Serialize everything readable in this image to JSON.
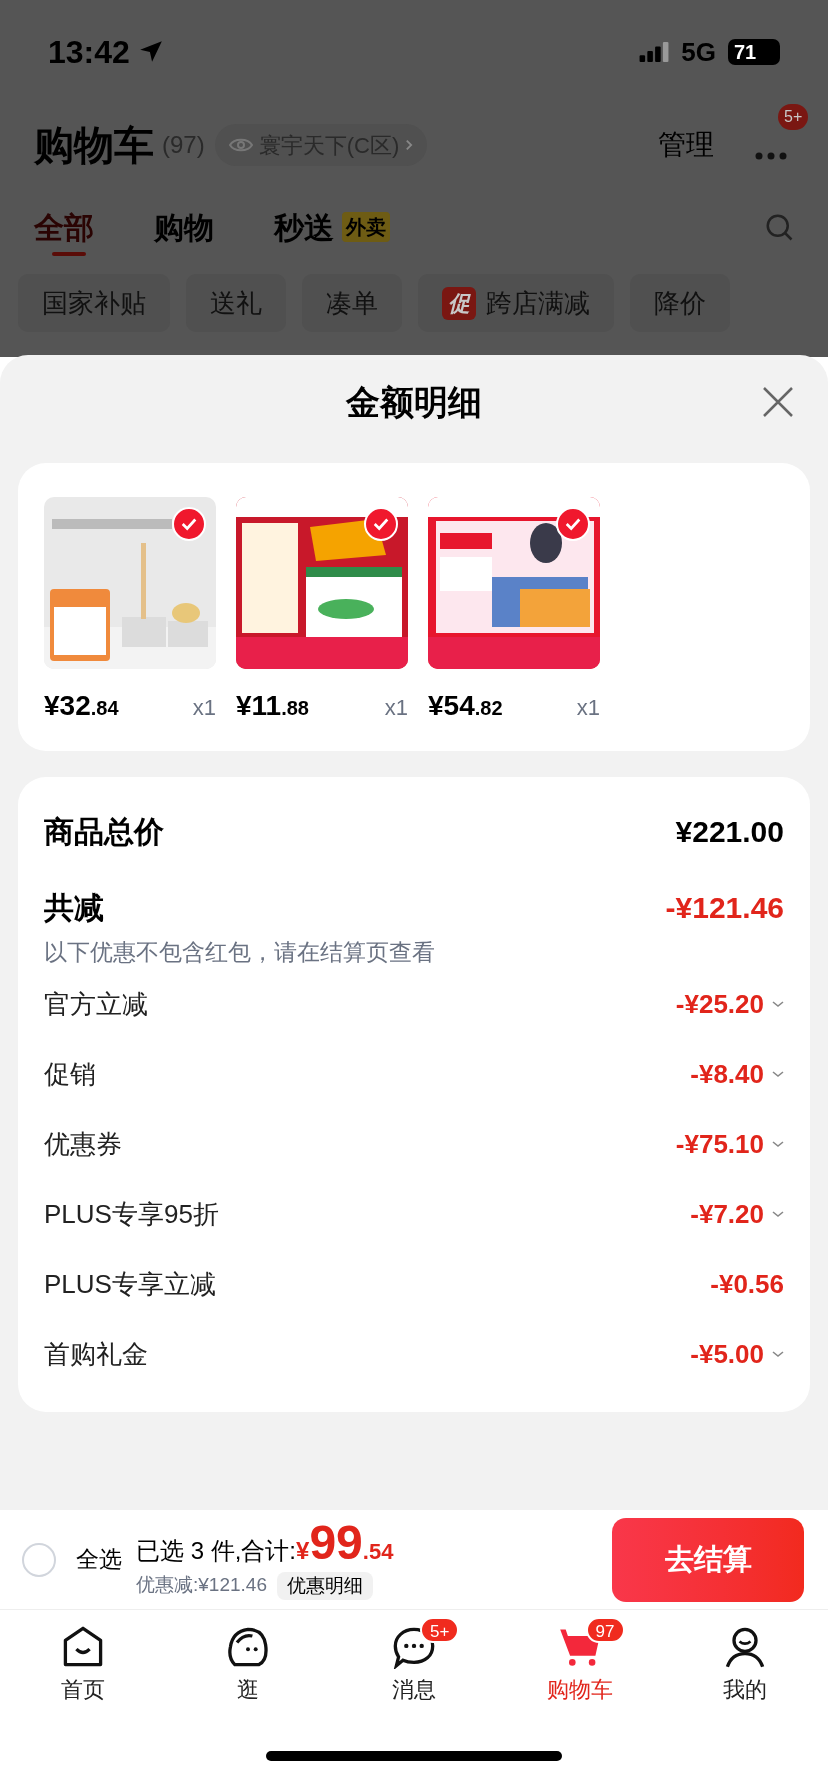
{
  "status_bar": {
    "time": "13:42",
    "network": "5G",
    "battery": "71"
  },
  "header": {
    "title": "购物车",
    "count": "(97)",
    "location": "寰宇天下(C区)",
    "manage": "管理",
    "more_badge": "5+"
  },
  "tabs": [
    {
      "label": "全部",
      "selected": true
    },
    {
      "label": "购物",
      "selected": false
    },
    {
      "label": "秒送",
      "selected": false,
      "tag": "外卖"
    }
  ],
  "chips": [
    {
      "label": "国家补贴"
    },
    {
      "label": "送礼"
    },
    {
      "label": "凑单"
    },
    {
      "label": "跨店满减",
      "tag": "促"
    },
    {
      "label": "降价"
    }
  ],
  "sheet": {
    "title": "金额明细",
    "products": [
      {
        "kind": "picture",
        "checked": true,
        "price_main": "¥32",
        "price_decimal": ".84",
        "quantity": "x1"
      },
      {
        "kind": "picture",
        "checked": true,
        "price_main": "¥11",
        "price_decimal": ".88",
        "quantity": "x1"
      },
      {
        "kind": "picture",
        "checked": true,
        "price_main": "¥54",
        "price_decimal": ".82",
        "quantity": "x1"
      }
    ],
    "total": {
      "label": "商品总价",
      "value": "¥221.00"
    },
    "reduction": {
      "label": "共减",
      "value": "-¥121.46",
      "note": "以下优惠不包含红包，请在结算页查看"
    },
    "discounts": [
      {
        "label": "官方立减",
        "value": "-¥25.20",
        "expandable": true
      },
      {
        "label": "促销",
        "value": "-¥8.40",
        "expandable": true
      },
      {
        "label": "优惠券",
        "value": "-¥75.10",
        "expandable": true
      },
      {
        "label": "PLUS专享95折",
        "value": "-¥7.20",
        "expandable": true
      },
      {
        "label": "PLUS专享立减",
        "value": "-¥0.56",
        "expandable": false
      },
      {
        "label": "首购礼金",
        "value": "-¥5.00",
        "expandable": true
      }
    ]
  },
  "checkout": {
    "select_all": {
      "label": "全选",
      "checked": false
    },
    "summary": "已选 3 件,合计:",
    "currency": "¥",
    "amount_main": "99",
    "amount_decimal": ".54",
    "discount": "优惠减:¥121.46",
    "details_button": "优惠明细",
    "submit": "去结算"
  },
  "tab_bar": [
    {
      "kind": "home",
      "label": "首页",
      "selected": false
    },
    {
      "kind": "explore",
      "label": "逛",
      "selected": false
    },
    {
      "kind": "message",
      "label": "消息",
      "selected": false,
      "badge": "5+"
    },
    {
      "kind": "cart",
      "label": "购物车",
      "selected": true,
      "badge": "97"
    },
    {
      "kind": "profile",
      "label": "我的",
      "selected": false
    }
  ]
}
